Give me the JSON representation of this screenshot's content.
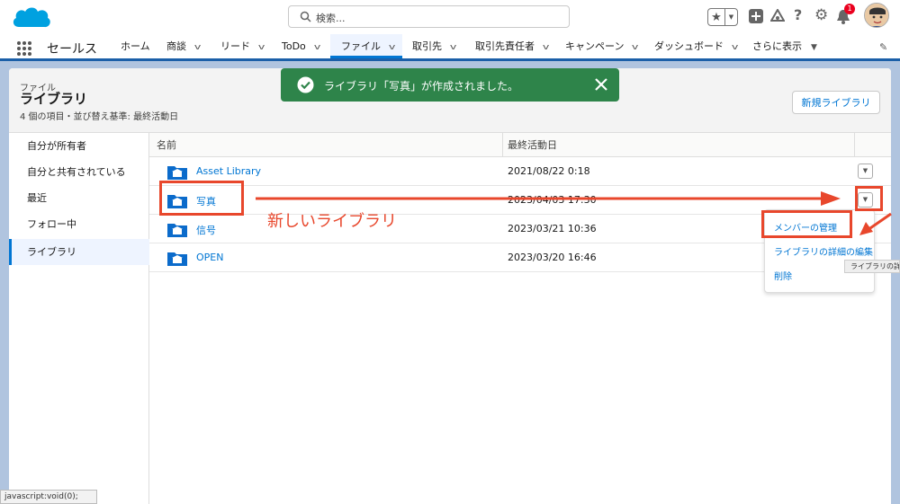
{
  "header": {
    "search_placeholder": "検索...",
    "notification_count": "1"
  },
  "nav": {
    "app_name": "セールス",
    "items": [
      {
        "label": "ホーム"
      },
      {
        "label": "商談"
      },
      {
        "label": "リード"
      },
      {
        "label": "ToDo"
      },
      {
        "label": "ファイル"
      },
      {
        "label": "取引先"
      },
      {
        "label": "取引先責任者"
      },
      {
        "label": "キャンペーン"
      },
      {
        "label": "ダッシュボード"
      },
      {
        "label": "さらに表示"
      }
    ]
  },
  "page": {
    "breadcrumb": "ファイル",
    "title": "ライブラリ",
    "subtitle": "4 個の項目・並び替え基準: 最終活動日",
    "new_button": "新規ライブラリ"
  },
  "toast": {
    "message": "ライブラリ「写真」が作成されました。"
  },
  "sidebar": {
    "items": [
      {
        "label": "自分が所有者"
      },
      {
        "label": "自分と共有されている"
      },
      {
        "label": "最近"
      },
      {
        "label": "フォロー中"
      },
      {
        "label": "ライブラリ"
      }
    ]
  },
  "table": {
    "headers": {
      "name": "名前",
      "last_activity": "最終活動日"
    },
    "rows": [
      {
        "name": "Asset Library",
        "date": "2021/08/22 0:18"
      },
      {
        "name": "写真",
        "date": "2023/04/03 17:30"
      },
      {
        "name": "信号",
        "date": "2023/03/21 10:36"
      },
      {
        "name": "OPEN",
        "date": "2023/03/20 16:46"
      }
    ]
  },
  "dropdown": {
    "items": [
      {
        "label": "メンバーの管理"
      },
      {
        "label": "ライブラリの詳細の編集"
      },
      {
        "label": "削除"
      }
    ],
    "tooltip": "ライブラリの詳細"
  },
  "annotation": {
    "label": "新しいライブラリ",
    "color": "#e8472c"
  },
  "status_bar": "javascript:void(0);",
  "colors": {
    "brand_blue": "#0176d3",
    "toast_green": "#2e844a",
    "nav_border": "#1b5fa8"
  }
}
